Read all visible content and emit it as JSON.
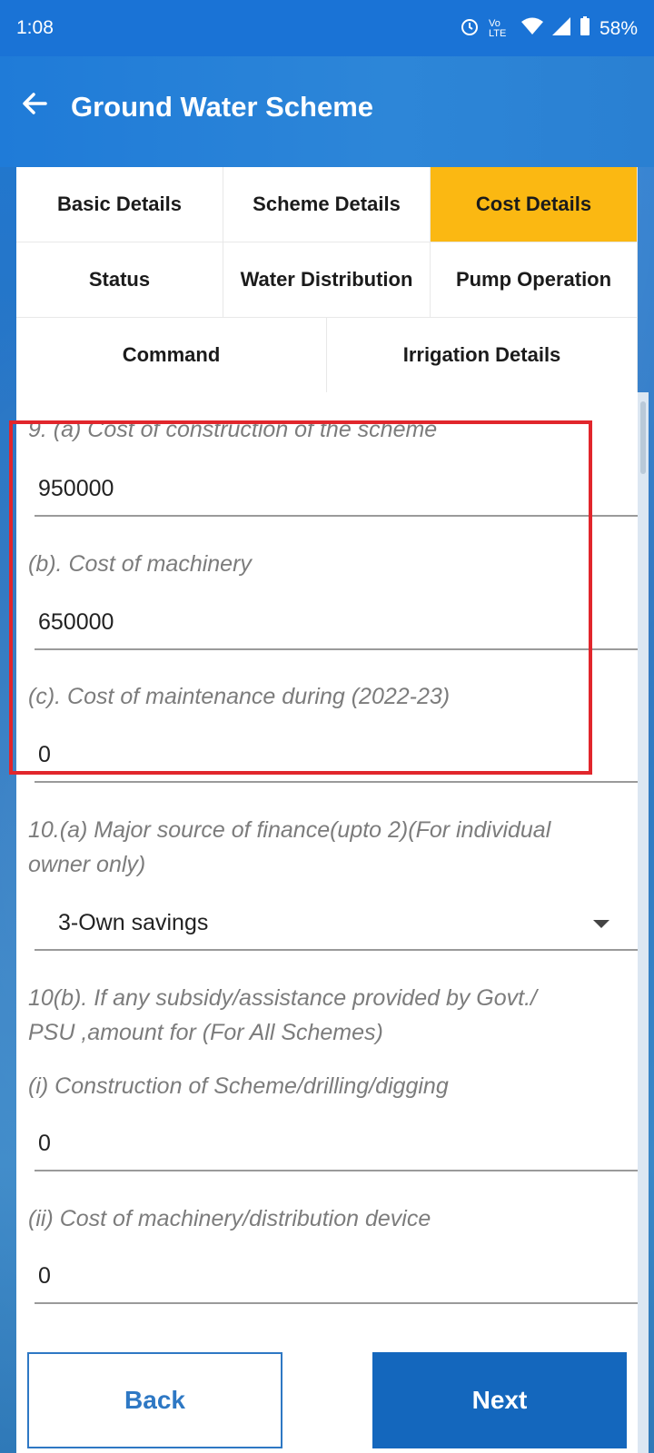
{
  "status_bar": {
    "time": "1:08",
    "network": "Vo LTE",
    "battery": "58%"
  },
  "app_bar": {
    "title": "Ground Water Scheme",
    "back_icon": "arrow-left-icon"
  },
  "tabs": [
    [
      {
        "label": "Basic Details",
        "active": false
      },
      {
        "label": "Scheme Details",
        "active": false
      },
      {
        "label": "Cost Details",
        "active": true
      }
    ],
    [
      {
        "label": "Status",
        "active": false
      },
      {
        "label": "Water Distribution",
        "active": false
      },
      {
        "label": "Pump Operation",
        "active": false
      }
    ],
    [
      {
        "label": "Command",
        "active": false
      },
      {
        "label": "Irrigation Details",
        "active": false
      }
    ]
  ],
  "form": {
    "q9a_label": "9. (a) Cost of construction of the scheme",
    "q9a_value": "950000",
    "q9b_label": "(b). Cost of machinery",
    "q9b_value": "650000",
    "q9c_label": "(c). Cost of maintenance during (2022-23)",
    "q9c_value": "0",
    "q10a_label_line1": "10.(a) Major source of finance(upto 2)(For individual",
    "q10a_label_line2": "owner only)",
    "q10a_value": "3-Own savings",
    "q10b_label_line1": "10(b). If any subsidy/assistance provided by Govt./",
    "q10b_label_line2": "PSU ,amount for (For All Schemes)",
    "q10b_i_label": "(i) Construction of Scheme/drilling/digging",
    "q10b_i_value": "0",
    "q10b_ii_label": "(ii) Cost of machinery/distribution device",
    "q10b_ii_value": "0"
  },
  "buttons": {
    "back_label": "Back",
    "next_label": "Next"
  },
  "colors": {
    "active_tab": "#fbb812",
    "primary": "#1467bd",
    "highlight": "#e1262c"
  }
}
